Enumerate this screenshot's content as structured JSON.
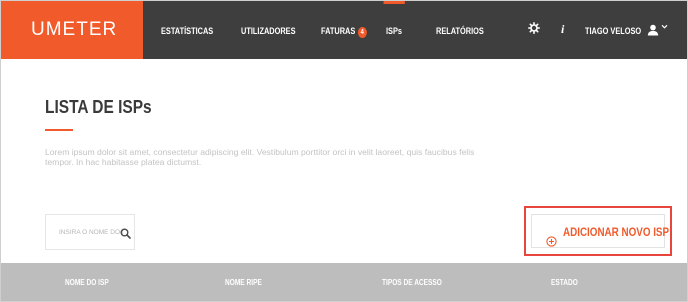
{
  "app": {
    "logo": "UMETER"
  },
  "nav": {
    "items": [
      {
        "label": "ESTATÍSTICAS"
      },
      {
        "label": "UTILIZADORES"
      },
      {
        "label": "FATURAS",
        "badge": "4"
      },
      {
        "label": "ISPs",
        "active": true
      },
      {
        "label": "RELATÓRIOS"
      }
    ],
    "settings_icon": "gear-icon",
    "info_icon": "info-icon",
    "user_name": "TIAGO VELOSO",
    "user_icon": "user-icon"
  },
  "page": {
    "title": "LISTA DE ISPs",
    "description": "Lorem ipsum dolor sit amet, consectetur adipiscing elit. Vestibulum porttitor orci in velit laoreet, quis faucibus felis tempor. In hac habitasse platea dictumst."
  },
  "search": {
    "placeholder": "INSIRA O NOME DO ISP",
    "value": "",
    "icon": "search-icon"
  },
  "add_button": {
    "label": "ADICIONAR NOVO ISP",
    "icon": "plus-circle-icon"
  },
  "table": {
    "columns": [
      "NOME DO ISP",
      "NOME RIPE",
      "TIPOS DE ACESSO",
      "ESTADO"
    ]
  },
  "colors": {
    "accent": "#f15a2b",
    "topbar": "#3e3e3e",
    "table_header": "#bdbdbd",
    "highlight": "#e8453c"
  }
}
